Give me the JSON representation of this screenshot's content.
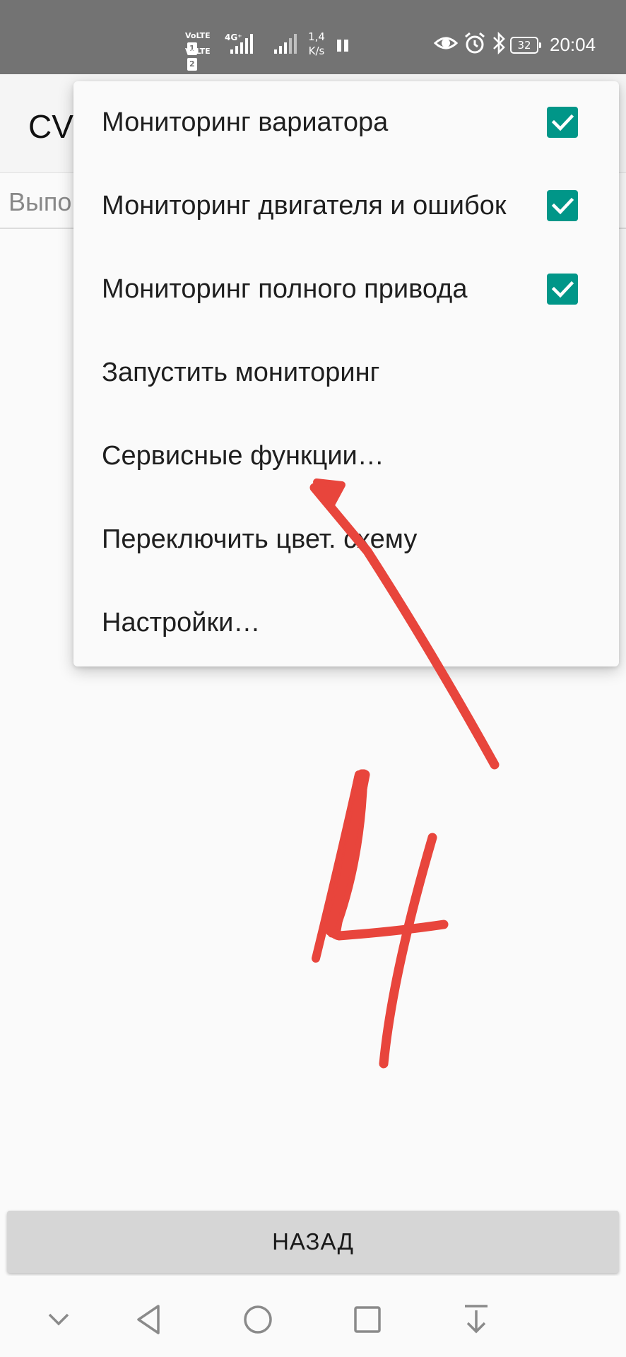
{
  "status_bar": {
    "volte1": "VoLTE",
    "volte1_sim": "1",
    "volte2": "VoLTE",
    "volte2_sim": "2",
    "network": "4G⁺",
    "speed_value": "1,4",
    "speed_unit": "K/s",
    "battery": "32",
    "time": "20:04"
  },
  "app": {
    "title": "CV",
    "tab_label": "Выпо"
  },
  "menu": {
    "items": [
      {
        "label": "Мониторинг вариатора",
        "checked": true
      },
      {
        "label": "Мониторинг двигателя и ошибок",
        "checked": true
      },
      {
        "label": "Мониторинг полного привода",
        "checked": true
      },
      {
        "label": "Запустить мониторинг"
      },
      {
        "label": "Сервисные функции…"
      },
      {
        "label": "Переключить цвет. схему"
      },
      {
        "label": "Настройки…"
      }
    ]
  },
  "back_button": {
    "label": "НАЗАД"
  },
  "colors": {
    "status_bar": "#737373",
    "checkbox": "#009688",
    "annotation": "#e8453c",
    "button": "#d6d6d6"
  }
}
